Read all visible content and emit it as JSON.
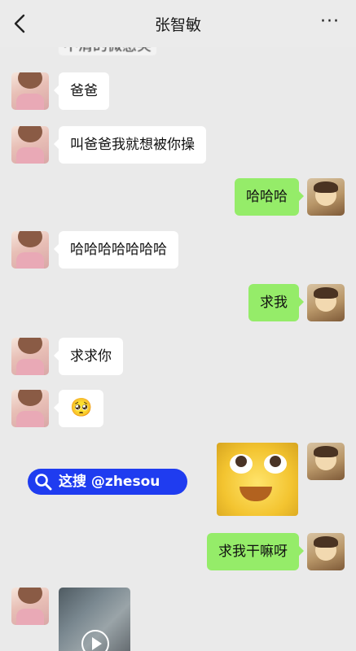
{
  "header": {
    "title": "张智敏",
    "more_label": "···"
  },
  "chat": {
    "partial_top_text": "不清的微感笑",
    "messages": [
      {
        "side": "left",
        "text": "爸爸"
      },
      {
        "side": "left",
        "text": "叫爸爸我就想被你操"
      },
      {
        "side": "right",
        "text": "哈哈哈"
      },
      {
        "side": "left",
        "text": "哈哈哈哈哈哈哈"
      },
      {
        "side": "right",
        "text": "求我"
      },
      {
        "side": "left",
        "text": "求求你"
      },
      {
        "side": "left",
        "text": "🥺"
      },
      {
        "side": "right",
        "text": "求我干嘛呀"
      }
    ]
  },
  "watermark": {
    "text": "这搜 @zhesou"
  }
}
